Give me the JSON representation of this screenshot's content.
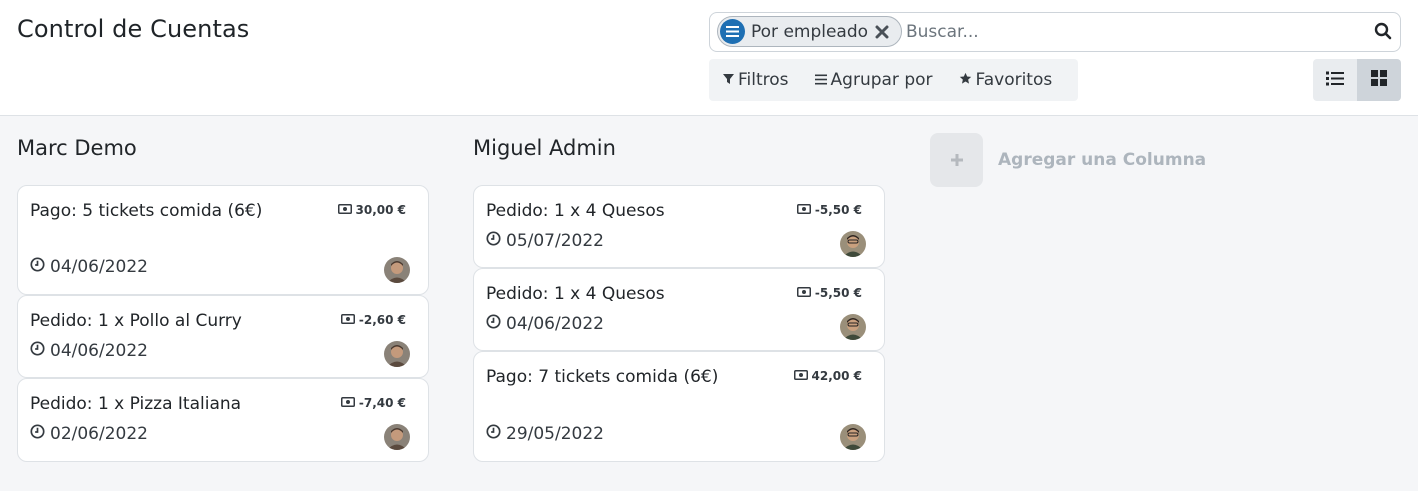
{
  "page": {
    "title": "Control de Cuentas"
  },
  "search": {
    "facet_label": "Por empleado",
    "placeholder": "Buscar..."
  },
  "filters": {
    "filters_label": "Filtros",
    "group_by_label": "Agrupar por",
    "favorites_label": "Favoritos"
  },
  "views": [
    "list",
    "kanban"
  ],
  "active_view": "kanban",
  "columns": [
    {
      "title": "Marc Demo",
      "cards": [
        {
          "title": "Pago: 5 tickets comida (6€)",
          "amount": "30,00 €",
          "date": "04/06/2022"
        },
        {
          "title": "Pedido: 1 x Pollo al Curry",
          "amount": "-2,60 €",
          "date": "04/06/2022"
        },
        {
          "title": "Pedido: 1 x Pizza Italiana",
          "amount": "-7,40 €",
          "date": "02/06/2022"
        }
      ]
    },
    {
      "title": "Miguel Admin",
      "cards": [
        {
          "title": "Pedido: 1 x 4 Quesos",
          "amount": "-5,50 €",
          "date": "05/07/2022"
        },
        {
          "title": "Pedido: 1 x 4 Quesos",
          "amount": "-5,50 €",
          "date": "04/06/2022"
        },
        {
          "title": "Pago: 7 tickets comida (6€)",
          "amount": "42,00 €",
          "date": "29/05/2022"
        }
      ]
    }
  ],
  "add_column": {
    "label": "Agregar una Columna"
  },
  "colors": {
    "accent": "#1e6fb3",
    "background": "#f5f6f8",
    "card_border": "#dee2e6"
  },
  "icons": {
    "facet": "group-by-icon",
    "facet_remove": "close-icon",
    "search": "search-icon",
    "filters": "filter-icon",
    "group_by": "bars-icon",
    "favorites": "star-icon",
    "list_view": "list-icon",
    "kanban_view": "grid-icon",
    "amount": "money-icon",
    "date": "clock-icon",
    "add_column": "plus-icon"
  }
}
